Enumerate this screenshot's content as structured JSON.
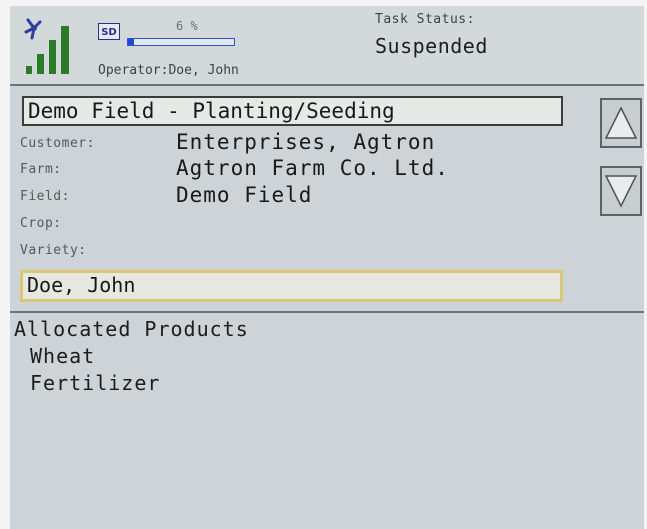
{
  "header": {
    "sd_label": "SD",
    "sd_percent": "6 %",
    "sd_usage_fraction": 0.06,
    "operator": "Operator:Doe, John",
    "task_status_title": "Task Status:",
    "task_status_value": "Suspended"
  },
  "task": {
    "title": "Demo Field - Planting/Seeding",
    "fields": [
      {
        "label": "Customer:",
        "value": "Enterprises, Agtron"
      },
      {
        "label": "Farm:",
        "value": "Agtron Farm Co. Ltd."
      },
      {
        "label": "Field:",
        "value": "Demo Field"
      },
      {
        "label": "Crop:",
        "value": ""
      },
      {
        "label": "Variety:",
        "value": ""
      }
    ],
    "operator_value": "Doe, John"
  },
  "products": {
    "title": "Allocated Products",
    "items": [
      "Wheat",
      "Fertilizer"
    ]
  },
  "icons": {
    "signal": "signal-strength-icon",
    "sd": "sd-card-icon",
    "up": "arrow-up-icon",
    "down": "arrow-down-icon"
  },
  "colors": {
    "screen_bg": "#cdd3d6",
    "signal_green": "#2a7a2a",
    "highlight_border": "#d8c779"
  }
}
